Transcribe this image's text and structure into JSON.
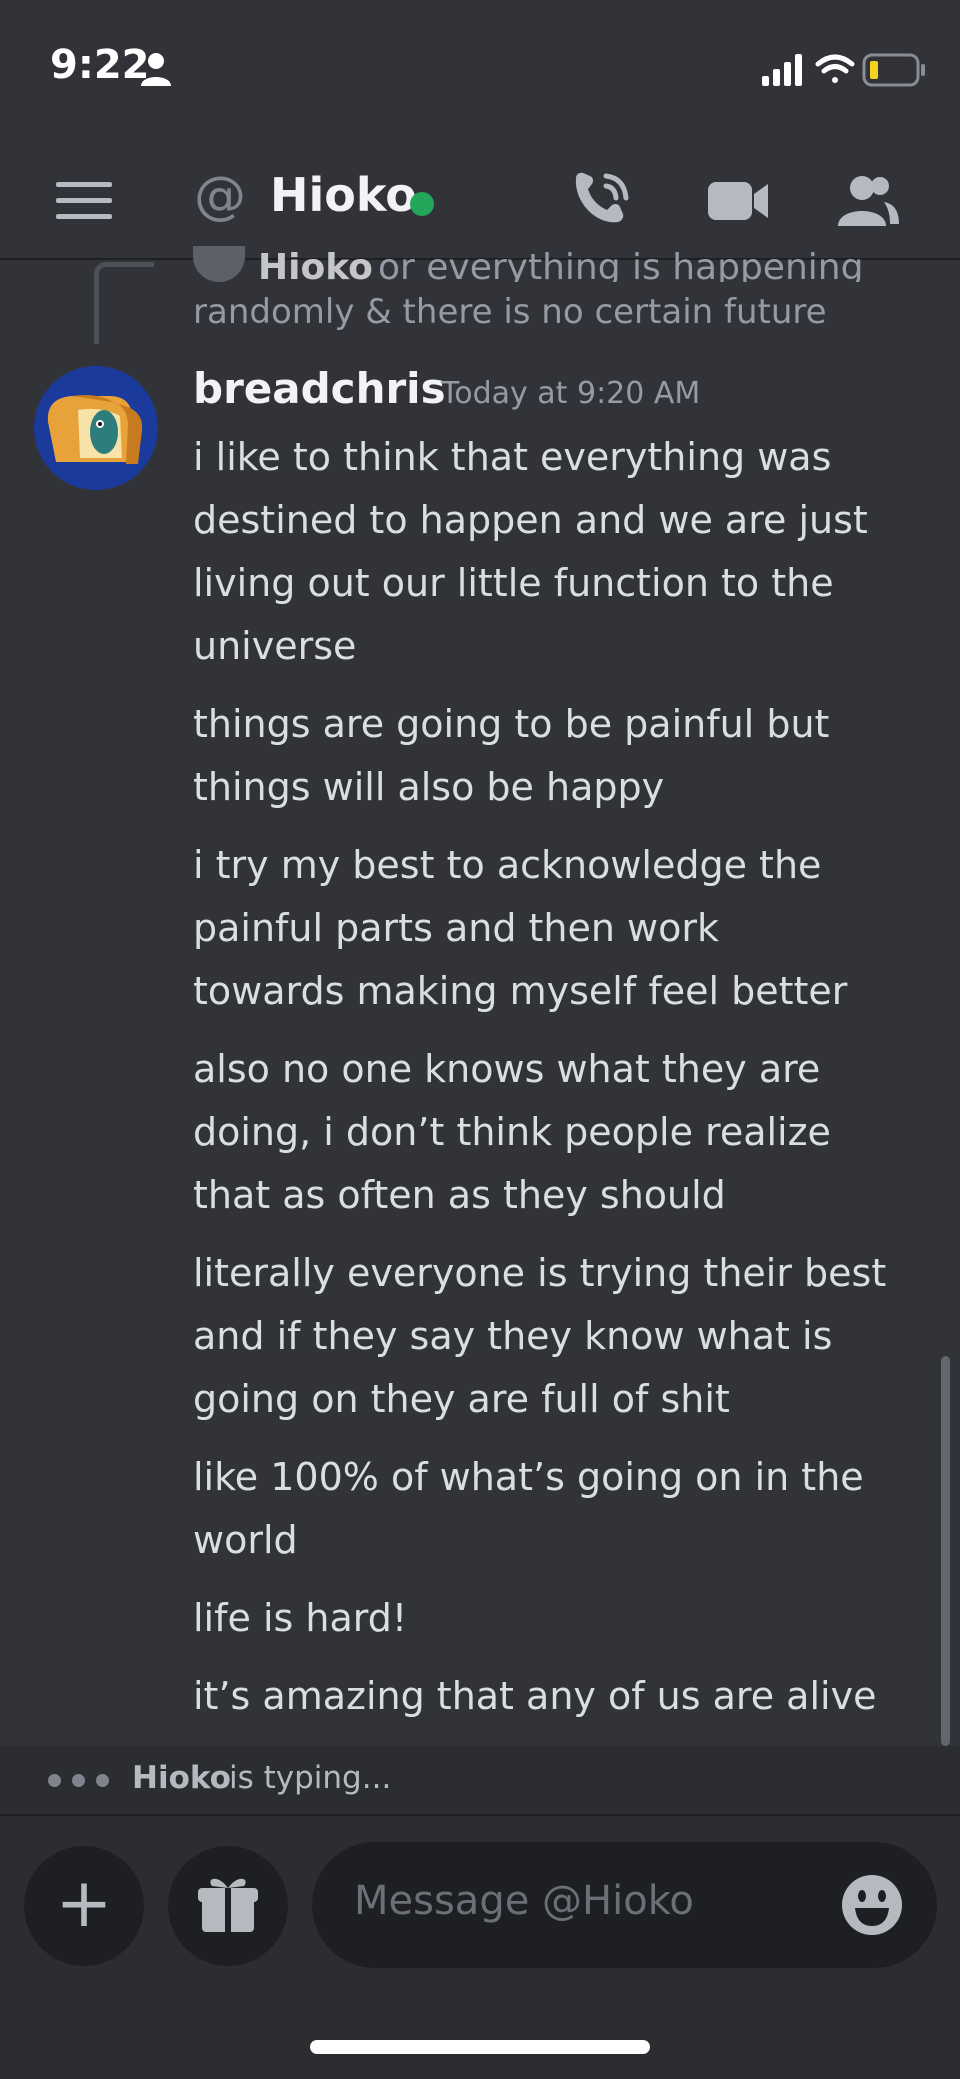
{
  "status_bar": {
    "time": "9:22"
  },
  "header": {
    "title": "Hioko",
    "at_symbol": "@"
  },
  "reply": {
    "author": "Hioko",
    "text_top": "or everything is happening",
    "text": "randomly & there is no certain future"
  },
  "message": {
    "author": "breadchris",
    "timestamp": "Today at 9:20 AM",
    "lines": [
      "i like to think that everything was\ndestined to happen and we are just\nliving out our little function to the\nuniverse",
      "things are going to be painful but\nthings will also be happy",
      "i try my best to acknowledge the\npainful parts and then work\ntowards making myself feel better",
      "also no one knows what they are\ndoing, i don’t think people realize\nthat as often as they should",
      "literally everyone is trying their best\nand if they say they know what is\ngoing on they are full of shit",
      "like 100% of what’s going on in the\nworld",
      "life is hard!",
      "it’s amazing that any of us are alive"
    ]
  },
  "typing": {
    "name": "Hioko",
    "suffix": "is typing..."
  },
  "composer": {
    "placeholder": "Message @Hioko",
    "plus_label": "+"
  },
  "colors": {
    "background": "#313338",
    "online": "#23a55a",
    "composer": "#2b2d31"
  }
}
